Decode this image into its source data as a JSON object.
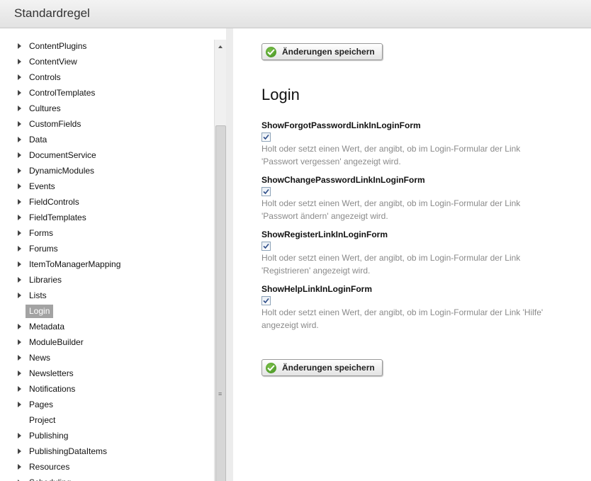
{
  "header": {
    "title": "Standardregel"
  },
  "sidebar": {
    "items": [
      {
        "label": "ContentPlugins",
        "expandable": true
      },
      {
        "label": "ContentView",
        "expandable": true
      },
      {
        "label": "Controls",
        "expandable": true
      },
      {
        "label": "ControlTemplates",
        "expandable": true
      },
      {
        "label": "Cultures",
        "expandable": true
      },
      {
        "label": "CustomFields",
        "expandable": true
      },
      {
        "label": "Data",
        "expandable": true
      },
      {
        "label": "DocumentService",
        "expandable": true
      },
      {
        "label": "DynamicModules",
        "expandable": true
      },
      {
        "label": "Events",
        "expandable": true
      },
      {
        "label": "FieldControls",
        "expandable": true
      },
      {
        "label": "FieldTemplates",
        "expandable": true
      },
      {
        "label": "Forms",
        "expandable": true
      },
      {
        "label": "Forums",
        "expandable": true
      },
      {
        "label": "ItemToManagerMapping",
        "expandable": true
      },
      {
        "label": "Libraries",
        "expandable": true
      },
      {
        "label": "Lists",
        "expandable": true
      },
      {
        "label": "Login",
        "expandable": false,
        "selected": true
      },
      {
        "label": "Metadata",
        "expandable": true
      },
      {
        "label": "ModuleBuilder",
        "expandable": true
      },
      {
        "label": "News",
        "expandable": true
      },
      {
        "label": "Newsletters",
        "expandable": true
      },
      {
        "label": "Notifications",
        "expandable": true
      },
      {
        "label": "Pages",
        "expandable": true
      },
      {
        "label": "Project",
        "expandable": false
      },
      {
        "label": "Publishing",
        "expandable": true
      },
      {
        "label": "PublishingDataItems",
        "expandable": true
      },
      {
        "label": "Resources",
        "expandable": true
      },
      {
        "label": "Scheduling",
        "expandable": true
      }
    ]
  },
  "main": {
    "save_label": "Änderungen speichern",
    "section_title": "Login",
    "settings": [
      {
        "name": "ShowForgotPasswordLinkInLoginForm",
        "checked": true,
        "desc_line1": "Holt oder setzt einen Wert, der angibt, ob im Login-Formular der Link",
        "desc_line2": "'Passwort vergessen' angezeigt wird."
      },
      {
        "name": "ShowChangePasswordLinkInLoginForm",
        "checked": true,
        "desc_line1": "Holt oder setzt einen Wert, der angibt, ob im Login-Formular der Link",
        "desc_line2": "'Passwort ändern' angezeigt wird."
      },
      {
        "name": "ShowRegisterLinkInLoginForm",
        "checked": true,
        "desc_line1": "Holt oder setzt einen Wert, der angibt, ob im Login-Formular der Link",
        "desc_line2": "'Registrieren' angezeigt wird."
      },
      {
        "name": "ShowHelpLinkInLoginForm",
        "checked": true,
        "desc_line1": "Holt oder setzt einen Wert, der angibt, ob im Login-Formular der Link 'Hilfe'",
        "desc_line2": "angezeigt wird."
      }
    ]
  }
}
